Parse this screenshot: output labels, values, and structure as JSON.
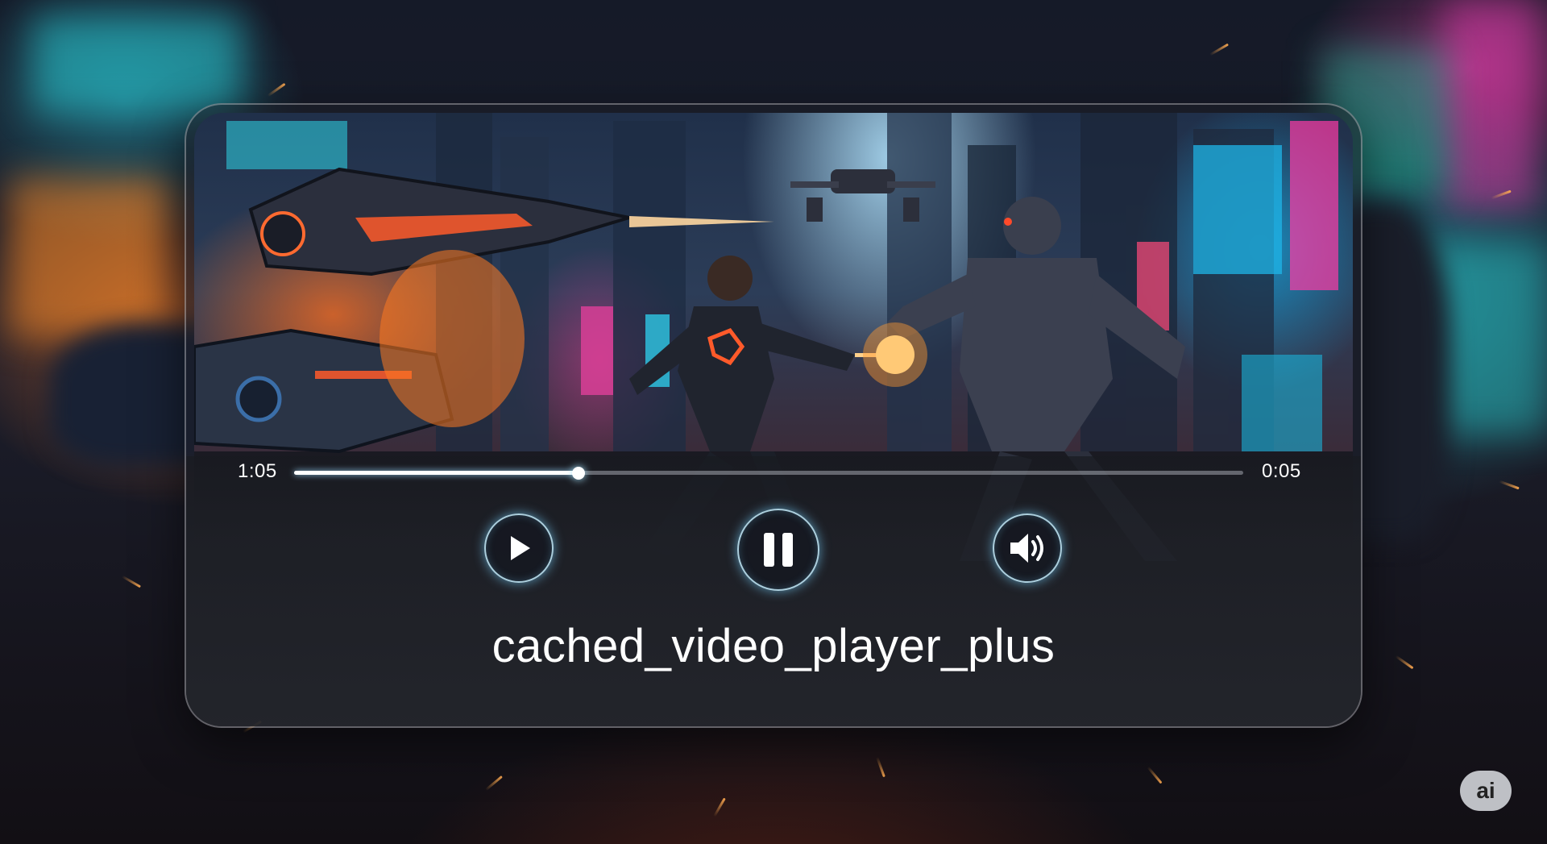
{
  "player": {
    "title": "cached_video_player_plus",
    "time_elapsed": "1:05",
    "time_remaining": "0:05",
    "progress_fraction": 0.3,
    "controls": {
      "play_icon": "play-icon",
      "pause_icon": "pause-icon",
      "volume_icon": "volume-icon"
    }
  },
  "badge": {
    "label": "ai"
  },
  "colors": {
    "accent_glow": "#7fd2ff",
    "text": "#ffffff",
    "card_border": "rgba(255,255,255,0.32)"
  }
}
